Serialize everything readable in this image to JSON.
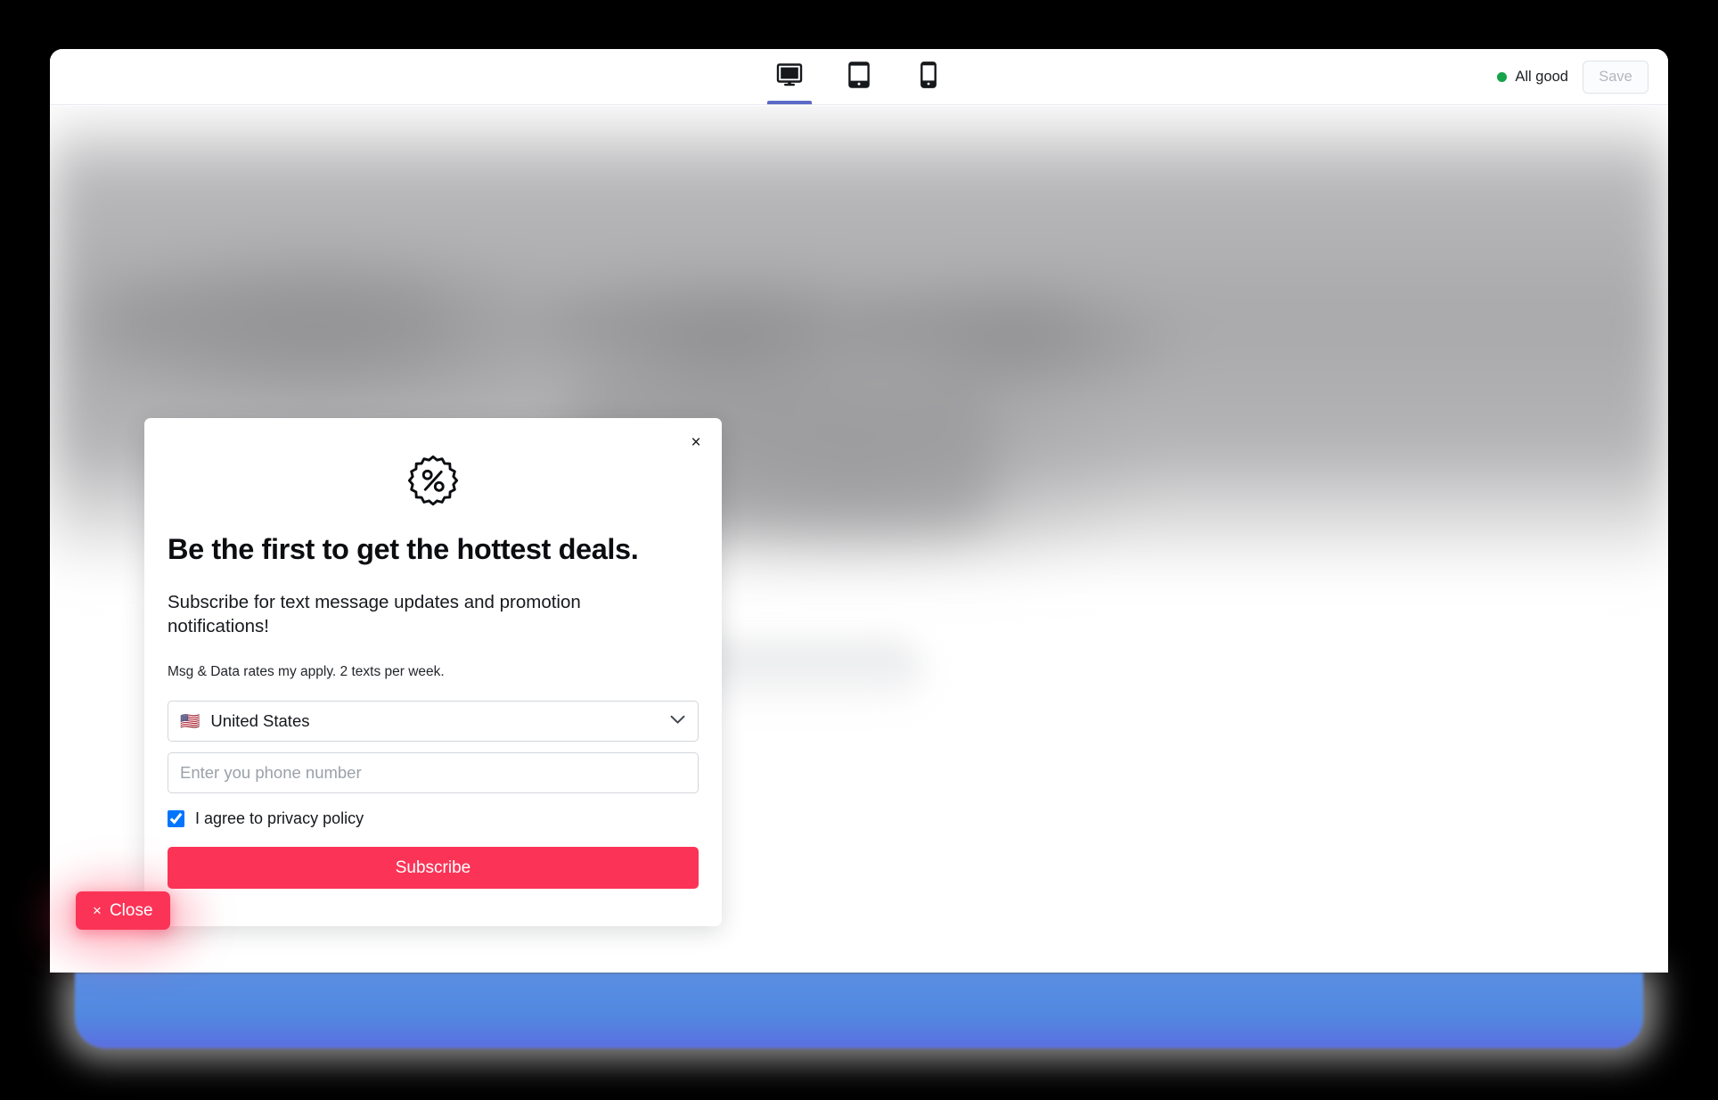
{
  "toolbar": {
    "devices": [
      {
        "name": "desktop",
        "label": "Desktop",
        "active": true
      },
      {
        "name": "tablet",
        "label": "Tablet",
        "active": false
      },
      {
        "name": "mobile",
        "label": "Mobile",
        "active": false
      }
    ],
    "status_text": "All good",
    "status_color": "#16a34a",
    "save_label": "Save"
  },
  "popup": {
    "close_icon": "×",
    "badge_icon": "percent-badge",
    "badge_symbol": "%",
    "headline": "Be the first to get the hottest deals.",
    "body": "Subscribe for text message updates and promotion notifications!",
    "fineprint": "Msg & Data rates my apply. 2 texts per week.",
    "country": {
      "flag": "🇺🇸",
      "selected": "United States",
      "chevron_icon": "chevron-down-icon"
    },
    "phone": {
      "value": "",
      "placeholder": "Enter you phone number"
    },
    "consent": {
      "label": "I agree to privacy policy",
      "checked": true
    },
    "submit_label": "Subscribe",
    "accent_color": "#fb3457"
  },
  "overlay": {
    "close_label": "Close",
    "close_icon": "×",
    "close_color": "#fb3457"
  },
  "theme": {
    "page_background": "#000000",
    "window_background": "#ffffff",
    "active_tab_underline": "#5c6bc7",
    "footer_band": "#5289e0"
  }
}
